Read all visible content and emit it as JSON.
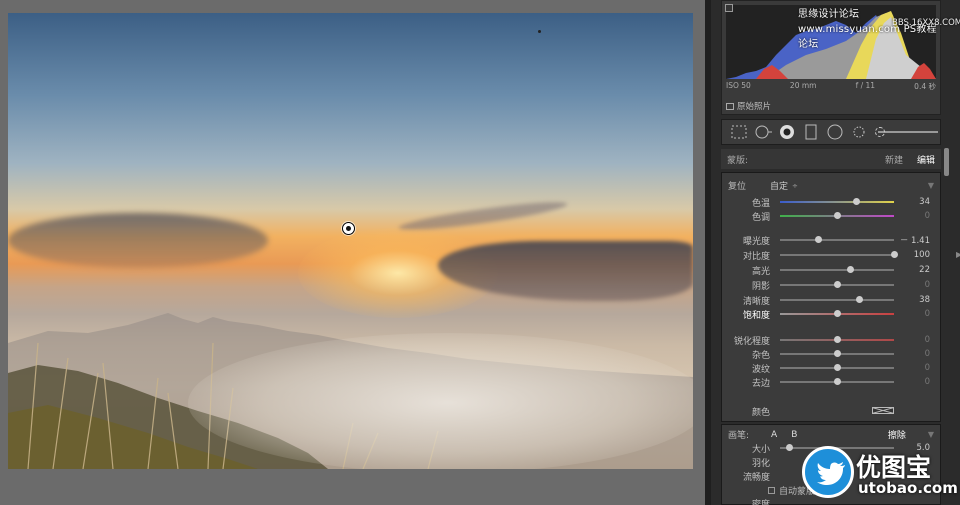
{
  "histogram": {
    "iso": "ISO 50",
    "focal": "20 mm",
    "aperture": "f / 11",
    "shutter": "0.4 秒",
    "original_label": "原始照片"
  },
  "watermark": {
    "line1": "思缘设计论坛  www.missyuan.com  PS教程论坛",
    "line2": "BBS.16XX8.COM"
  },
  "mask": {
    "label": "蒙版:",
    "new_label": "新建",
    "edit_label": "编辑"
  },
  "effect": {
    "reset_label": "复位",
    "preset_value": "自定",
    "preset_caret": "÷"
  },
  "sliders": [
    {
      "label": "色温",
      "value": "34",
      "pos": 0.67,
      "track": "temp"
    },
    {
      "label": "色调",
      "value": "0",
      "pos": 0.5,
      "track": "tint"
    },
    {
      "label": "曝光度",
      "value": "－ 1.41",
      "pos": 0.33,
      "track": "gray"
    },
    {
      "label": "对比度",
      "value": "100",
      "pos": 1.0,
      "track": "gray"
    },
    {
      "label": "高光",
      "value": "22",
      "pos": 0.61,
      "track": "gray"
    },
    {
      "label": "阴影",
      "value": "0",
      "pos": 0.5,
      "track": "gray"
    },
    {
      "label": "清晰度",
      "value": "38",
      "pos": 0.69,
      "track": "gray"
    },
    {
      "label": "饱和度",
      "value": "0",
      "pos": 0.5,
      "track": "sat"
    },
    {
      "label": "锐化程度",
      "value": "0",
      "pos": 0.5,
      "track": "sharp"
    },
    {
      "label": "杂色",
      "value": "0",
      "pos": 0.5,
      "track": "gray"
    },
    {
      "label": "波纹",
      "value": "0",
      "pos": 0.5,
      "track": "gray"
    },
    {
      "label": "去边",
      "value": "0",
      "pos": 0.5,
      "track": "gray"
    }
  ],
  "color_label": "颜色",
  "brush": {
    "label": "画笔:",
    "a": "A",
    "b": "B",
    "erase": "擦除",
    "size_label": "大小",
    "size_value": "5.0",
    "feather_label": "羽化",
    "flow_label": "流畅度",
    "auto_mask_label": "自动蒙版",
    "density_label": "密度"
  },
  "logo": {
    "name": "优图宝",
    "url": "utobao.com"
  },
  "colors": {
    "panel_bg": "#2b2b2b",
    "section_bg": "#3b3b3b",
    "accent_blue": "#1e8fd9"
  }
}
